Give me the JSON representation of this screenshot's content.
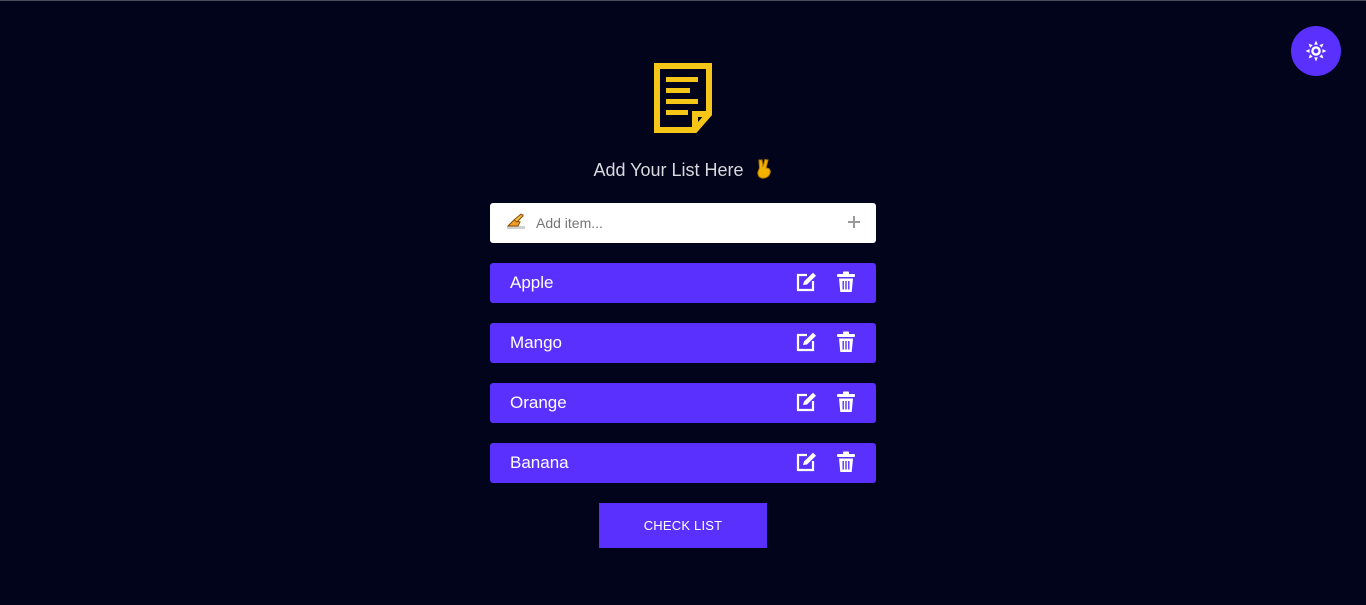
{
  "header": {
    "logo_icon": "notepad-icon",
    "title": "Add Your List Here",
    "hand_icon": "victory-hand-icon"
  },
  "add_item": {
    "icon": "writing-hand-icon",
    "placeholder": "Add item...",
    "value": "",
    "add_icon": "plus-icon"
  },
  "items": [
    {
      "label": "Apple"
    },
    {
      "label": "Mango"
    },
    {
      "label": "Orange"
    },
    {
      "label": "Banana"
    }
  ],
  "item_actions": {
    "edit_icon": "edit-icon",
    "delete_icon": "trash-icon"
  },
  "check_button": {
    "label": "CHECK LIST"
  },
  "theme_toggle": {
    "icon": "sun-icon"
  },
  "colors": {
    "background": "#01041a",
    "accent": "#5a30ff",
    "logo": "#f5c518",
    "text": "#d9d9df"
  }
}
